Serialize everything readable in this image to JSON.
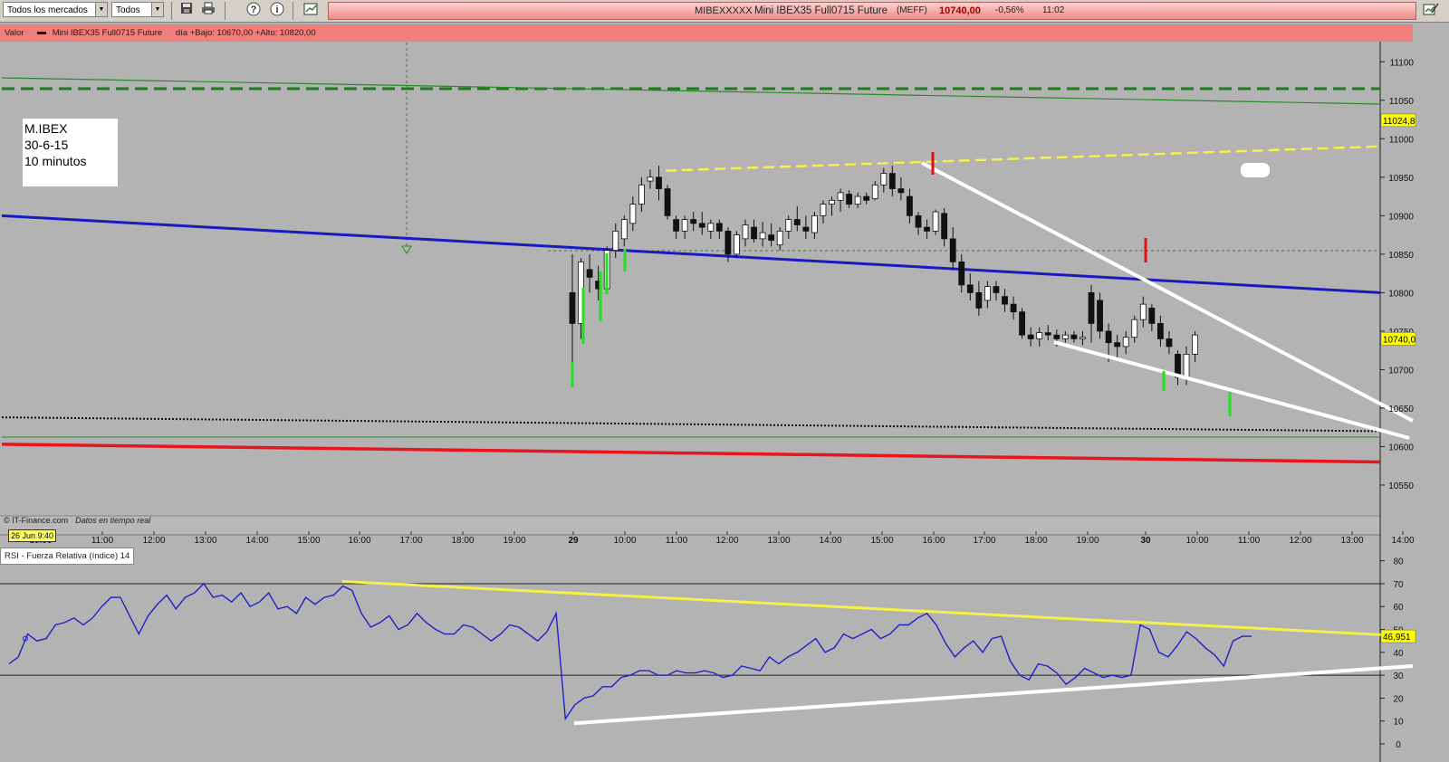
{
  "toolbar": {
    "market_select": "Todos los mercados",
    "filter_select": "Todos"
  },
  "ticker": {
    "code": "MIBEXXXXX",
    "name": "Mini IBEX35 Full0715 Future",
    "exchange": "(MEFF)",
    "price": "10740,00",
    "change": "-0,56%",
    "time": "11:02"
  },
  "info_bar": {
    "label": "Valor",
    "series": "Mini IBEX35 Full0715 Future",
    "stats": "día +Bajo: 10670,00 +Alto: 10820,00"
  },
  "annotation": {
    "line1": "M.IBEX",
    "line2": "30-6-15",
    "line3": "10 minutos"
  },
  "price_axis": {
    "ticks": [
      "11100",
      "11050",
      "11000",
      "10950",
      "10900",
      "10850",
      "10800",
      "10750",
      "10700",
      "10650",
      "10600",
      "10550"
    ],
    "marker_top": "11024,8",
    "marker_price": "10740,0"
  },
  "time_axis": {
    "labels": [
      "10:00",
      "11:00",
      "12:00",
      "13:00",
      "14:00",
      "15:00",
      "16:00",
      "17:00",
      "18:00",
      "19:00",
      "29",
      "10:00",
      "11:00",
      "12:00",
      "13:00",
      "14:00",
      "15:00",
      "16:00",
      "17:00",
      "18:00",
      "19:00",
      "30",
      "10:00",
      "11:00",
      "12:00",
      "13:00",
      "14:00"
    ],
    "cursor_date": "26 Jun 9:40"
  },
  "credit": {
    "source": "© IT-Finance.com",
    "note": "Datos en tiempo real"
  },
  "rsi": {
    "label": "RSI - Fuerza Relativa (índice) 14",
    "ticks": [
      "80",
      "70",
      "60",
      "50",
      "40",
      "30",
      "20",
      "10",
      "0"
    ],
    "value": "46,951"
  },
  "colors": {
    "background": "#b3b3b3",
    "info_bar": "#f07f7b",
    "support_red": "#e8141e",
    "trend_blue": "#1a1abf",
    "channel_yellow": "#f5f04a",
    "wedge_white": "#ffffff",
    "green_dashed": "#1d7a1d",
    "rsi_line": "#2020c8"
  },
  "icons": [
    "save-icon",
    "print-icon",
    "help-icon",
    "info-icon",
    "chart-link-icon",
    "edit-chart-icon"
  ],
  "chart_data": {
    "type": "candlestick",
    "title": "Mini IBEX35 Full0715 Future",
    "ylim": [
      10510,
      11125
    ],
    "y_ticks": [
      11100,
      11050,
      11000,
      10950,
      10900,
      10850,
      10800,
      10750,
      10700,
      10650,
      10600,
      10550
    ],
    "x_labels": [
      "10:00",
      "11:00",
      "12:00",
      "13:00",
      "14:00",
      "15:00",
      "16:00",
      "17:00",
      "18:00",
      "19:00",
      "29",
      "10:00",
      "11:00",
      "12:00",
      "13:00",
      "14:00",
      "15:00",
      "16:00",
      "17:00",
      "18:00",
      "19:00",
      "30",
      "10:00",
      "11:00",
      "12:00",
      "13:00",
      "14:00"
    ],
    "candles_ohlc": [
      [
        10800,
        10850,
        10700,
        10760
      ],
      [
        10760,
        10845,
        10740,
        10840
      ],
      [
        10830,
        10850,
        10800,
        10820
      ],
      [
        10815,
        10835,
        10790,
        10805
      ],
      [
        10805,
        10860,
        10800,
        10855
      ],
      [
        10855,
        10890,
        10845,
        10880
      ],
      [
        10870,
        10900,
        10860,
        10895
      ],
      [
        10890,
        10925,
        10880,
        10915
      ],
      [
        10915,
        10950,
        10905,
        10940
      ],
      [
        10945,
        10960,
        10935,
        10950
      ],
      [
        10950,
        10965,
        10920,
        10935
      ],
      [
        10935,
        10940,
        10895,
        10900
      ],
      [
        10895,
        10900,
        10870,
        10880
      ],
      [
        10880,
        10900,
        10870,
        10895
      ],
      [
        10895,
        10905,
        10880,
        10890
      ],
      [
        10890,
        10905,
        10875,
        10885
      ],
      [
        10880,
        10895,
        10870,
        10890
      ],
      [
        10890,
        10895,
        10870,
        10880
      ],
      [
        10880,
        10885,
        10840,
        10850
      ],
      [
        10850,
        10880,
        10845,
        10875
      ],
      [
        10870,
        10895,
        10860,
        10888
      ],
      [
        10885,
        10895,
        10865,
        10870
      ],
      [
        10870,
        10892,
        10860,
        10878
      ],
      [
        10875,
        10890,
        10860,
        10868
      ],
      [
        10862,
        10885,
        10855,
        10880
      ],
      [
        10880,
        10900,
        10870,
        10895
      ],
      [
        10895,
        10912,
        10880,
        10888
      ],
      [
        10885,
        10900,
        10870,
        10880
      ],
      [
        10878,
        10905,
        10870,
        10900
      ],
      [
        10900,
        10920,
        10890,
        10915
      ],
      [
        10915,
        10925,
        10900,
        10920
      ],
      [
        10920,
        10935,
        10905,
        10930
      ],
      [
        10928,
        10933,
        10910,
        10915
      ],
      [
        10915,
        10930,
        10910,
        10925
      ],
      [
        10925,
        10930,
        10915,
        10920
      ],
      [
        10922,
        10945,
        10920,
        10940
      ],
      [
        10940,
        10962,
        10930,
        10955
      ],
      [
        10955,
        10965,
        10925,
        10935
      ],
      [
        10935,
        10950,
        10920,
        10930
      ],
      [
        10925,
        10935,
        10890,
        10900
      ],
      [
        10900,
        10905,
        10875,
        10885
      ],
      [
        10885,
        10895,
        10870,
        10880
      ],
      [
        10880,
        10908,
        10875,
        10905
      ],
      [
        10903,
        10910,
        10860,
        10870
      ],
      [
        10870,
        10885,
        10830,
        10840
      ],
      [
        10840,
        10850,
        10800,
        10810
      ],
      [
        10810,
        10825,
        10790,
        10800
      ],
      [
        10800,
        10815,
        10770,
        10780
      ],
      [
        10790,
        10815,
        10780,
        10808
      ],
      [
        10808,
        10815,
        10790,
        10800
      ],
      [
        10795,
        10805,
        10775,
        10785
      ],
      [
        10785,
        10795,
        10765,
        10775
      ],
      [
        10775,
        10780,
        10740,
        10745
      ],
      [
        10745,
        10755,
        10730,
        10740
      ],
      [
        10740,
        10755,
        10730,
        10748
      ],
      [
        10748,
        10758,
        10738,
        10745
      ],
      [
        10745,
        10752,
        10730,
        10740
      ],
      [
        10740,
        10750,
        10735,
        10745
      ],
      [
        10745,
        10750,
        10735,
        10740
      ],
      [
        10740,
        10750,
        10732,
        10742
      ],
      [
        10800,
        10810,
        10735,
        10760
      ],
      [
        10790,
        10800,
        10740,
        10750
      ],
      [
        10750,
        10760,
        10710,
        10735
      ],
      [
        10735,
        10745,
        10715,
        10730
      ],
      [
        10730,
        10750,
        10720,
        10742
      ],
      [
        10742,
        10770,
        10735,
        10765
      ],
      [
        10765,
        10795,
        10755,
        10785
      ],
      [
        10780,
        10785,
        10750,
        10760
      ],
      [
        10760,
        10770,
        10730,
        10740
      ],
      [
        10740,
        10750,
        10720,
        10730
      ],
      [
        10720,
        10725,
        10680,
        10690
      ],
      [
        10690,
        10730,
        10680,
        10720
      ],
      [
        10720,
        10750,
        10710,
        10745
      ]
    ],
    "overlays": {
      "blue_trendline": [
        10900,
        10800
      ],
      "red_support": [
        10603,
        10580
      ],
      "yellow_dashed_top": [
        10962,
        10990
      ],
      "green_dashed_resistance": 11060,
      "black_dotted": [
        10638,
        10620
      ]
    },
    "rsi_14": {
      "ylim": [
        0,
        85
      ],
      "values": [
        35,
        38,
        48,
        45,
        46,
        52,
        53,
        55,
        52,
        55,
        60,
        64,
        64,
        56,
        48,
        56,
        61,
        65,
        59,
        64,
        66,
        70,
        64,
        65,
        62,
        66,
        60,
        62,
        66,
        59,
        60,
        57,
        64,
        61,
        64,
        65,
        69,
        67,
        57,
        51,
        53,
        56,
        50,
        52,
        57,
        53,
        50,
        48,
        48,
        52,
        51,
        48,
        45,
        48,
        52,
        51,
        48,
        45,
        49,
        57,
        11,
        17,
        20,
        21,
        25,
        25,
        29,
        30,
        32,
        32,
        30,
        30,
        32,
        31,
        31,
        32,
        31,
        29,
        30,
        34,
        33,
        32,
        38,
        35,
        38,
        40,
        43,
        46,
        40,
        42,
        48,
        46,
        48,
        50,
        46,
        48,
        52,
        52,
        55,
        57,
        52,
        44,
        38,
        42,
        45,
        40,
        46,
        47,
        36,
        30,
        28,
        35,
        34,
        31,
        26,
        29,
        33,
        31,
        29,
        30,
        29,
        30,
        52,
        50,
        40,
        38,
        43,
        49,
        46,
        42,
        39,
        34,
        45,
        47,
        47
      ],
      "yellow_resistance": [
        71,
        47
      ],
      "white_support": [
        9,
        34
      ],
      "reference_lines": [
        70,
        30
      ]
    }
  }
}
